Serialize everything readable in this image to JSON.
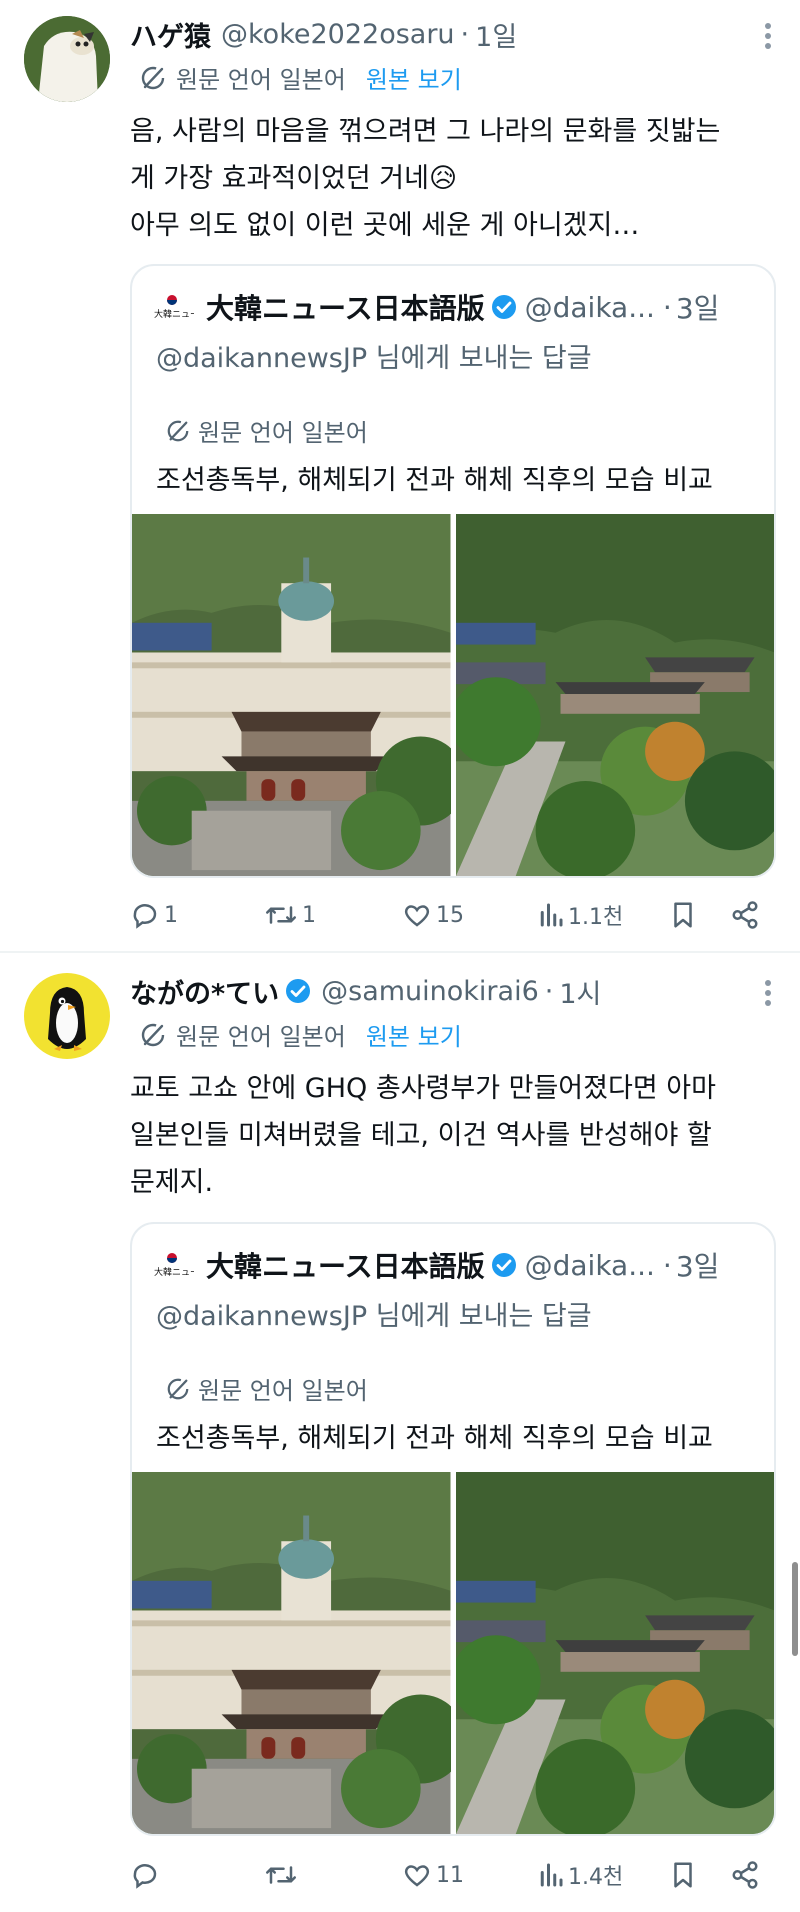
{
  "tweets": [
    {
      "display_name": "ハゲ猿",
      "handle": "@koke2022osaru",
      "time": "1일",
      "translate_label": "원문 언어 일본어",
      "show_original": "원본 보기",
      "text_lines": [
        "음, 사람의 마음을 꺾으려면 그 나라의 문화를 짓밟는",
        "게 가장 효과적이었던 거네😥",
        "아무 의도 없이 이런 곳에 세운 게 아니겠지…"
      ],
      "quote": {
        "name": "大韓ニュース日本語版",
        "handle": "@daika...",
        "time": "3일",
        "reply_to": "@daikannewsJP 님에게 보내는 답글",
        "translate_label": "원문 언어 일본어",
        "text": "조선총독부, 해체되기 전과 해체 직후의 모습 비교"
      },
      "actions": {
        "replies": "1",
        "retweets": "1",
        "likes": "15",
        "views": "1.1천"
      }
    },
    {
      "display_name": "ながの*てい",
      "handle": "@samuinokirai6",
      "time": "1시",
      "translate_label": "원문 언어 일본어",
      "show_original": "원본 보기",
      "text_lines": [
        "교토 고쇼 안에 GHQ 총사령부가 만들어졌다면 아마",
        "일본인들 미쳐버렸을 테고, 이건 역사를 반성해야 할",
        "문제지."
      ],
      "quote": {
        "name": "大韓ニュース日本語版",
        "handle": "@daika...",
        "time": "3일",
        "reply_to": "@daikannewsJP 님에게 보내는 답글",
        "translate_label": "원문 언어 일본어",
        "text": "조선총독부, 해체되기 전과 해체 직후의 모습 비교"
      },
      "actions": {
        "replies": "",
        "retweets": "",
        "likes": "11",
        "views": "1.4천"
      }
    }
  ],
  "colors": {
    "accent": "#1d9bf0",
    "secondary_text": "#536471",
    "primary_text": "#0f1419",
    "border": "#e6ecf0",
    "verified": "#1d9bf0"
  },
  "icons": [
    "more-icon",
    "translate-icon",
    "verified-icon",
    "reply-icon",
    "retweet-icon",
    "like-icon",
    "views-icon",
    "bookmark-icon",
    "share-icon"
  ]
}
